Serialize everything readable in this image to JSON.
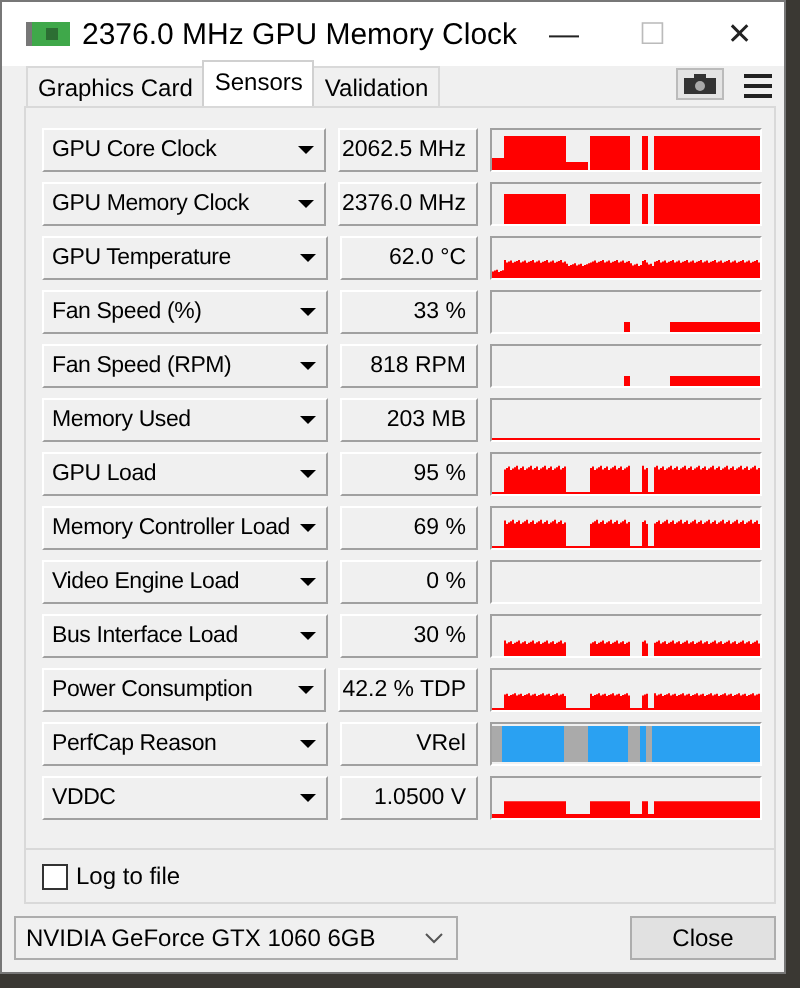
{
  "window": {
    "title": "2376.0 MHz GPU Memory Clock",
    "controls": [
      "—",
      "☐",
      "✕"
    ]
  },
  "tabs": [
    {
      "label": "Graphics Card",
      "selected": false
    },
    {
      "label": "Sensors",
      "selected": true
    },
    {
      "label": "Validation",
      "selected": false
    }
  ],
  "sensors": [
    {
      "name": "GPU Core Clock",
      "value": "2062.5 MHz",
      "kind": "clock"
    },
    {
      "name": "GPU Memory Clock",
      "value": "2376.0 MHz",
      "kind": "clock2"
    },
    {
      "name": "GPU Temperature",
      "value": "62.0 °C",
      "kind": "temp"
    },
    {
      "name": "Fan Speed (%)",
      "value": "33 %",
      "kind": "fan"
    },
    {
      "name": "Fan Speed (RPM)",
      "value": "818 RPM",
      "kind": "fan"
    },
    {
      "name": "Memory Used",
      "value": "203 MB",
      "kind": "flat"
    },
    {
      "name": "GPU Load",
      "value": "95 %",
      "kind": "load"
    },
    {
      "name": "Memory Controller Load",
      "value": "69 %",
      "kind": "load"
    },
    {
      "name": "Video Engine Load",
      "value": "0 %",
      "kind": "empty"
    },
    {
      "name": "Bus Interface Load",
      "value": "30 %",
      "kind": "low"
    },
    {
      "name": "Power Consumption",
      "value": "42.2 % TDP",
      "kind": "power"
    },
    {
      "name": "PerfCap Reason",
      "value": "VRel",
      "kind": "perfcap"
    },
    {
      "name": "VDDC",
      "value": "1.0500 V",
      "kind": "volt"
    }
  ],
  "log_to_file": {
    "label": "Log to file",
    "checked": false
  },
  "gpu_select": {
    "value": "NVIDIA GeForce GTX 1060 6GB"
  },
  "close_button": "Close"
}
